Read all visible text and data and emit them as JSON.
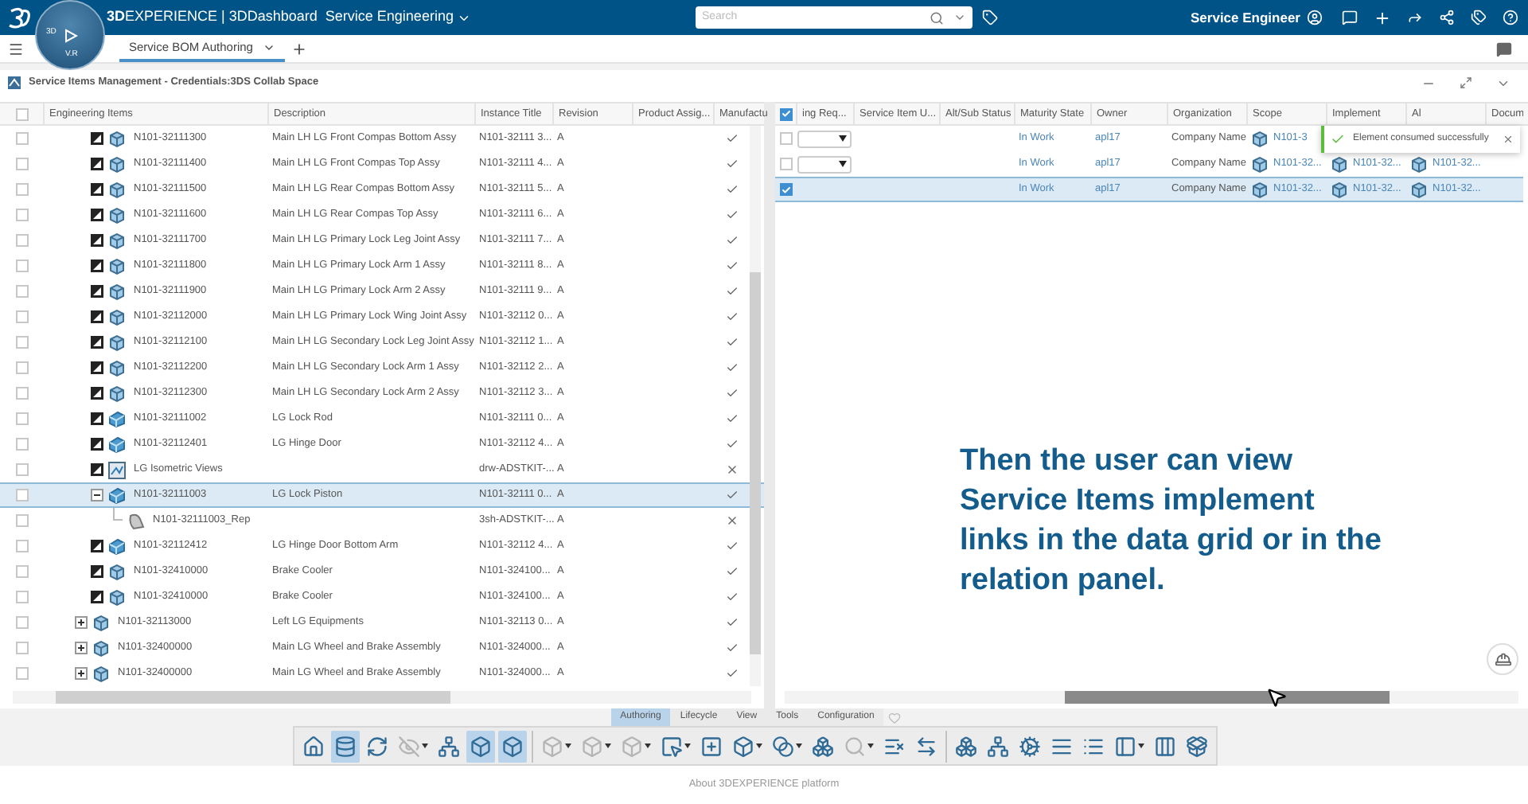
{
  "top_bar": {
    "title": "**3D**EXPERIENCE | 3DDashboard",
    "dashboard": "Service Engineering",
    "search": {
      "placeholder": "Search"
    },
    "user": "Service Engineer"
  },
  "compass": {
    "left": "3D",
    "bottom": "V.R"
  },
  "tabs": [
    {
      "label": "Service BOM Authoring",
      "selected": true
    }
  ],
  "panel": {
    "title": "Service Items Management - Credentials:3DS Collab Space"
  },
  "left_grid": {
    "all_checked": false,
    "columns": [
      "Engineering Items",
      "Description",
      "Instance Title",
      "Revision",
      "Product Assig...",
      "Manufactu"
    ],
    "nested_rows": [
      {
        "item": "N101-32111300",
        "description": "Main LH LG Front Compas Bottom Assy",
        "instance_title": "N101-32111 3...",
        "revision": "A",
        "mark": true,
        "kind": "product",
        "selected": false
      },
      {
        "item": "N101-32111400",
        "description": "Main LH LG Front Compas Top Assy",
        "instance_title": "N101-32111 4...",
        "revision": "A",
        "mark": true,
        "kind": "product",
        "selected": false
      },
      {
        "item": "N101-32111500",
        "description": "Main LH LG Rear Compas Bottom Assy",
        "instance_title": "N101-32111 5...",
        "revision": "A",
        "mark": true,
        "kind": "product",
        "selected": false
      },
      {
        "item": "N101-32111600",
        "description": "Main LH LG Rear Compas Top Assy",
        "instance_title": "N101-32111 6...",
        "revision": "A",
        "mark": true,
        "kind": "product",
        "selected": false
      },
      {
        "item": "N101-32111700",
        "description": "Main LH LG Primary Lock Leg Joint Assy",
        "instance_title": "N101-32111 7...",
        "revision": "A",
        "mark": true,
        "kind": "product",
        "selected": false
      },
      {
        "item": "N101-32111800",
        "description": "Main LH LG Primary Lock Arm 1 Assy",
        "instance_title": "N101-32111 8...",
        "revision": "A",
        "mark": true,
        "kind": "product",
        "selected": false
      },
      {
        "item": "N101-32111900",
        "description": "Main LH LG Primary Lock Arm 2 Assy",
        "instance_title": "N101-32111 9...",
        "revision": "A",
        "mark": true,
        "kind": "product",
        "selected": false
      },
      {
        "item": "N101-32112000",
        "description": "Main LH LG Primary Lock Wing Joint Assy",
        "instance_title": "N101-32112 0...",
        "revision": "A",
        "mark": true,
        "kind": "product",
        "selected": false
      },
      {
        "item": "N101-32112100",
        "description": "Main LH LG Secondary Lock Leg Joint Assy",
        "instance_title": "N101-32112 1...",
        "revision": "A",
        "mark": true,
        "kind": "product",
        "selected": false
      },
      {
        "item": "N101-32112200",
        "description": "Main LH LG Secondary Lock Arm 1 Assy",
        "instance_title": "N101-32112 2...",
        "revision": "A",
        "mark": true,
        "kind": "product",
        "selected": false
      },
      {
        "item": "N101-32112300",
        "description": "Main LH LG Secondary Lock Arm 2 Assy",
        "instance_title": "N101-32112 3...",
        "revision": "A",
        "mark": true,
        "kind": "product",
        "selected": false
      },
      {
        "item": "N101-32111002",
        "description": "LG Lock Rod",
        "instance_title": "N101-32111 0...",
        "revision": "A",
        "mark": true,
        "kind": "part",
        "selected": false
      },
      {
        "item": "N101-32112401",
        "description": "LG Hinge Door",
        "instance_title": "N101-32112 4...",
        "revision": "A",
        "mark": true,
        "kind": "part",
        "selected": false
      },
      {
        "item": "LG Isometric Views",
        "instance_title": "drw-ADSTKIT-...",
        "revision": "A",
        "mark": false,
        "kind": "drawing",
        "selected": false
      },
      {
        "item": "N101-32111003",
        "description": "LG Lock Piston",
        "instance_title": "N101-32111 0...",
        "revision": "A",
        "mark": true,
        "kind": "part",
        "selected": true,
        "expanded": true,
        "children": [
          {
            "item": "N101-32111003_Rep",
            "instance_title": "3sh-ADSTKIT-...",
            "revision": "A",
            "mark": false,
            "kind": "representation",
            "selected": false
          }
        ]
      },
      {
        "item": "N101-32112412",
        "description": "LG Hinge Door Bottom Arm",
        "instance_title": "N101-32112 4...",
        "revision": "A",
        "mark": true,
        "kind": "part",
        "selected": false
      },
      {
        "item": "N101-32410000",
        "description": "Brake Cooler",
        "instance_title": "N101-324100...",
        "revision": "A",
        "mark": true,
        "kind": "product",
        "selected": false
      },
      {
        "item": "N101-32410000",
        "description": "Brake Cooler",
        "instance_title": "N101-324100...",
        "revision": "A",
        "mark": true,
        "kind": "product",
        "selected": false
      }
    ],
    "top_rows": [
      {
        "item": "N101-32113000",
        "description": "Left LG Equipments",
        "instance_title": "N101-32113 0...",
        "revision": "A",
        "mark": true,
        "kind": "product",
        "selected": false,
        "expanded": false
      },
      {
        "item": "N101-32400000",
        "description": "Main LG Wheel and Brake Assembly",
        "instance_title": "N101-324000...",
        "revision": "A",
        "mark": true,
        "kind": "product",
        "selected": false,
        "expanded": false
      },
      {
        "item": "N101-32400000",
        "description": "Main LG Wheel and Brake Assembly",
        "instance_title": "N101-324000...",
        "revision": "A",
        "mark": true,
        "kind": "product",
        "selected": false,
        "expanded": false
      }
    ]
  },
  "right_grid": {
    "all_checked": true,
    "columns": [
      "ing Req...",
      "Service Item U...",
      "Alt/Sub Status",
      "Maturity State",
      "Owner",
      "Organization",
      "Scope",
      "Implement",
      "Al",
      "Docum"
    ],
    "rows": [
      {
        "dropdown": true,
        "checked": false,
        "selected": false,
        "maturity_state": "In Work",
        "owner": "apl17",
        "organization": "Company Name",
        "scope": "N101-3"
      },
      {
        "dropdown": true,
        "checked": false,
        "selected": false,
        "maturity_state": "In Work",
        "owner": "apl17",
        "organization": "Company Name",
        "scope": "N101-32...",
        "implement": "N101-32...",
        "column_9": "N101-32..."
      },
      {
        "dropdown": false,
        "checked": true,
        "selected": true,
        "maturity_state": "In Work",
        "owner": "apl17",
        "organization": "Company Name",
        "scope": "N101-32...",
        "implement": "N101-32...",
        "column_9": "N101-32..."
      }
    ]
  },
  "toast": {
    "message": "Element consumed successfully"
  },
  "caption": "Then the user can view Service Items implement links in the data grid or in the relation panel.",
  "action_tabs": [
    {
      "label": "Authoring",
      "selected": true
    },
    {
      "label": "Lifecycle",
      "selected": false
    },
    {
      "label": "View",
      "selected": false
    },
    {
      "label": "Tools",
      "selected": false
    },
    {
      "label": "Configuration",
      "selected": false
    }
  ],
  "toolbar": [
    {
      "selected": false,
      "menu": false,
      "disabled": false
    },
    {
      "selected": true,
      "menu": false,
      "disabled": false
    },
    {
      "selected": false,
      "menu": false,
      "disabled": false
    },
    {
      "selected": false,
      "menu": true,
      "disabled": true
    },
    {
      "selected": false,
      "menu": false,
      "disabled": false
    },
    {
      "selected": true,
      "menu": false,
      "disabled": false
    },
    {
      "selected": true,
      "menu": false,
      "disabled": false
    },
    {
      "selected": false,
      "menu": true,
      "disabled": true
    },
    {
      "selected": false,
      "menu": true,
      "disabled": true
    },
    {
      "selected": false,
      "menu": true,
      "disabled": true
    },
    {
      "selected": false,
      "menu": true,
      "disabled": false
    },
    {
      "selected": false,
      "menu": false,
      "disabled": false
    },
    {
      "selected": false,
      "menu": true,
      "disabled": false
    },
    {
      "selected": false,
      "menu": true,
      "disabled": false
    },
    {
      "selected": false,
      "menu": false,
      "disabled": false
    },
    {
      "selected": false,
      "menu": true,
      "disabled": true
    },
    {
      "selected": false,
      "menu": false,
      "disabled": false
    },
    {
      "selected": false,
      "menu": false,
      "disabled": false
    },
    {
      "selected": false,
      "menu": false,
      "disabled": false
    },
    {
      "selected": false,
      "menu": false,
      "disabled": false
    },
    {
      "selected": false,
      "menu": false,
      "disabled": false
    },
    {
      "selected": false,
      "menu": false,
      "disabled": false
    },
    {
      "selected": false,
      "menu": false,
      "disabled": false
    },
    {
      "selected": false,
      "menu": true,
      "disabled": false
    },
    {
      "selected": false,
      "menu": false,
      "disabled": false
    },
    {
      "selected": false,
      "menu": false,
      "disabled": false
    }
  ],
  "footer": "About 3DEXPERIENCE platform"
}
